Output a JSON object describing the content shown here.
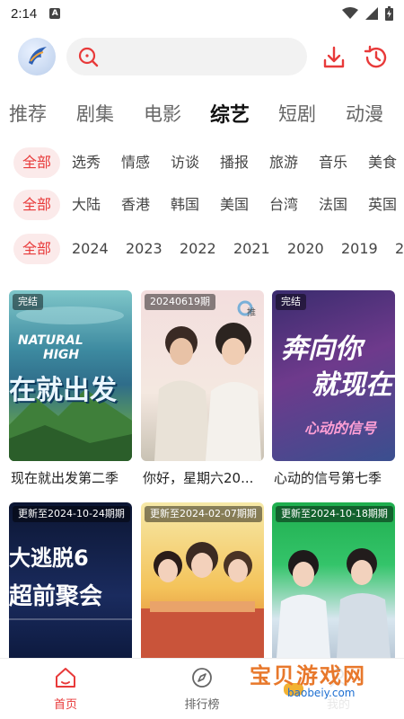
{
  "status": {
    "time": "2:14",
    "notif_letter": "A"
  },
  "search": {
    "placeholder": ""
  },
  "categories": [
    "推荐",
    "剧集",
    "电影",
    "综艺",
    "短剧",
    "动漫"
  ],
  "genres": [
    "全部",
    "选秀",
    "情感",
    "访谈",
    "播报",
    "旅游",
    "音乐",
    "美食"
  ],
  "regions": [
    "全部",
    "大陆",
    "香港",
    "韩国",
    "美国",
    "台湾",
    "法国",
    "英国"
  ],
  "years": [
    "全部",
    "2024",
    "2023",
    "2022",
    "2021",
    "2020",
    "2019",
    "2"
  ],
  "cards": [
    {
      "badge": "完结",
      "title": "现在就出发第二季",
      "poster_line1": "NATURAL",
      "poster_line2": "HIGH",
      "poster_line3": "在就出发"
    },
    {
      "badge": "20240619期",
      "title": "你好，星期六20...",
      "poster_corner": "推"
    },
    {
      "badge": "完结",
      "title": "心动的信号第七季",
      "poster_line1": "奔向你",
      "poster_line2": "就现在",
      "poster_line3": "心动的信号"
    },
    {
      "badge": "更新至2024-10-24期期",
      "title": "",
      "poster_line1": "大逃脱6",
      "poster_line2": "超前聚会"
    },
    {
      "badge": "更新至2024-02-07期期",
      "title": ""
    },
    {
      "badge": "更新至2024-10-18期期",
      "title": ""
    }
  ],
  "nav": {
    "home": "首页",
    "rank": "排行榜",
    "mine": "我的"
  },
  "watermark": {
    "text": "宝贝游戏网",
    "url": "baobeiy.com"
  },
  "colors": {
    "accent": "#e83a3a",
    "chip_bg": "#fbeaea"
  }
}
